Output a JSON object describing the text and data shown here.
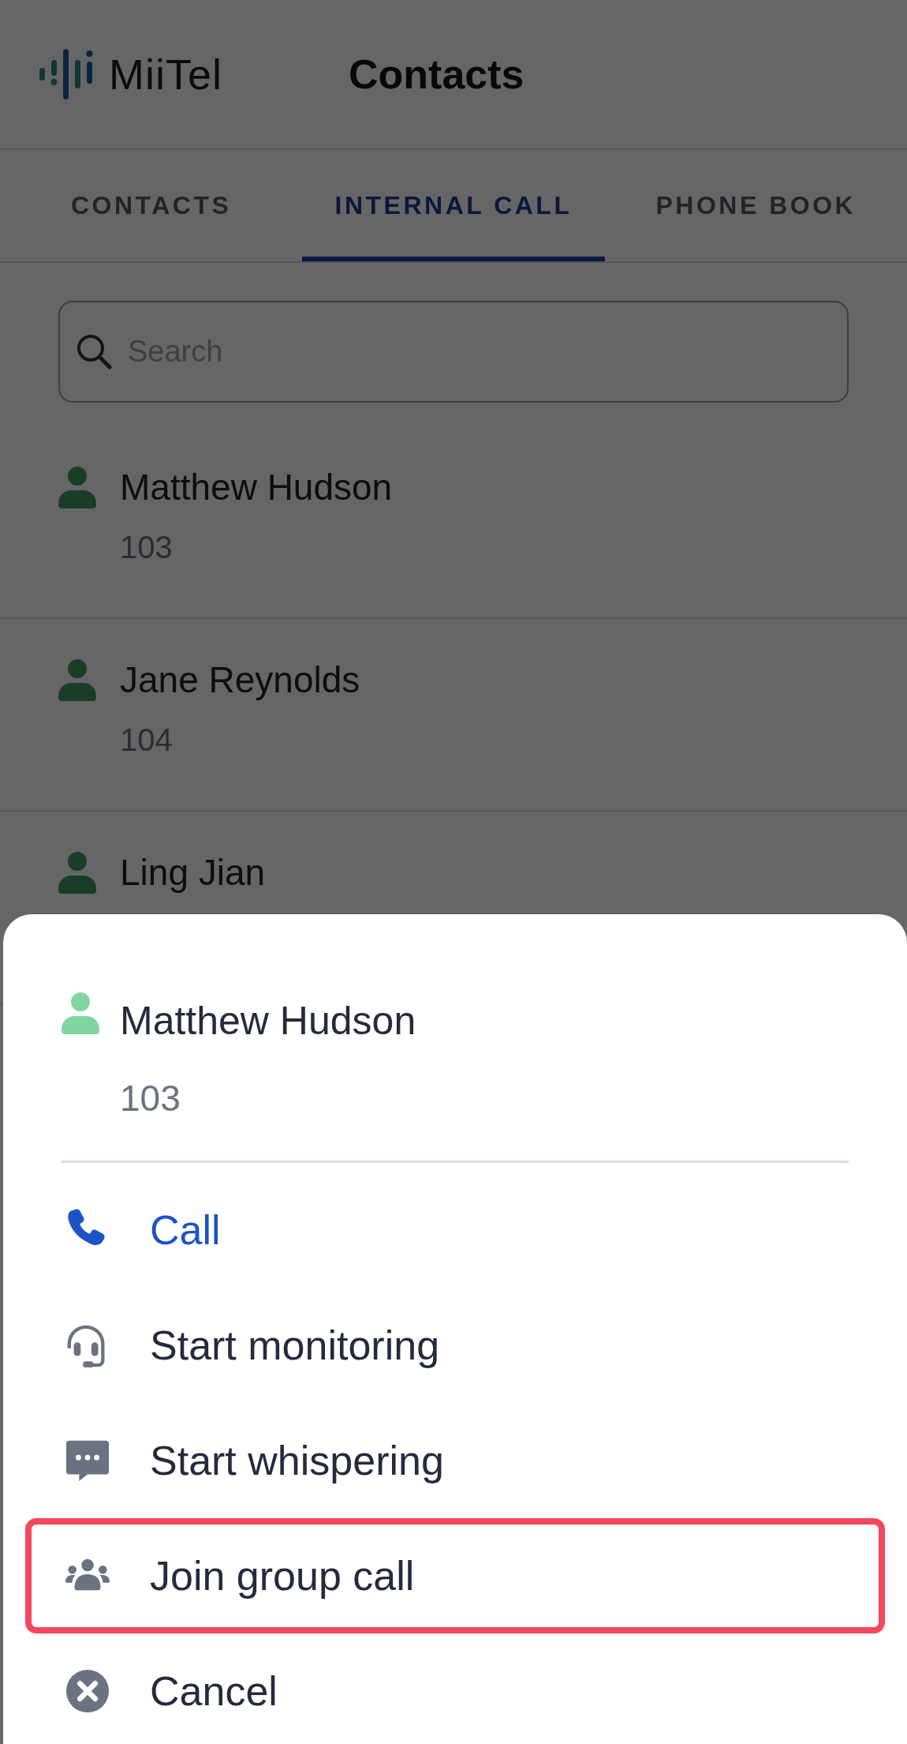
{
  "header": {
    "logo_text": "MiiTel",
    "title": "Contacts"
  },
  "tabs": [
    {
      "label": "CONTACTS",
      "selected": false
    },
    {
      "label": "INTERNAL CALL",
      "selected": true
    },
    {
      "label": "PHONE BOOK",
      "selected": false
    }
  ],
  "search": {
    "placeholder": "Search"
  },
  "contacts": [
    {
      "name": "Matthew Hudson",
      "extension": "103"
    },
    {
      "name": "Jane Reynolds",
      "extension": "104"
    },
    {
      "name": "Ling Jian"
    }
  ],
  "sheet": {
    "contact": {
      "name": "Matthew Hudson",
      "extension": "103"
    },
    "actions": [
      {
        "label": "Call",
        "kind": "call",
        "highlighted": false
      },
      {
        "label": "Start monitoring",
        "kind": "monitor",
        "highlighted": false
      },
      {
        "label": "Start whispering",
        "kind": "whisper",
        "highlighted": false
      },
      {
        "label": "Join group call",
        "kind": "group",
        "highlighted": true
      },
      {
        "label": "Cancel",
        "kind": "cancel",
        "highlighted": false
      }
    ]
  }
}
